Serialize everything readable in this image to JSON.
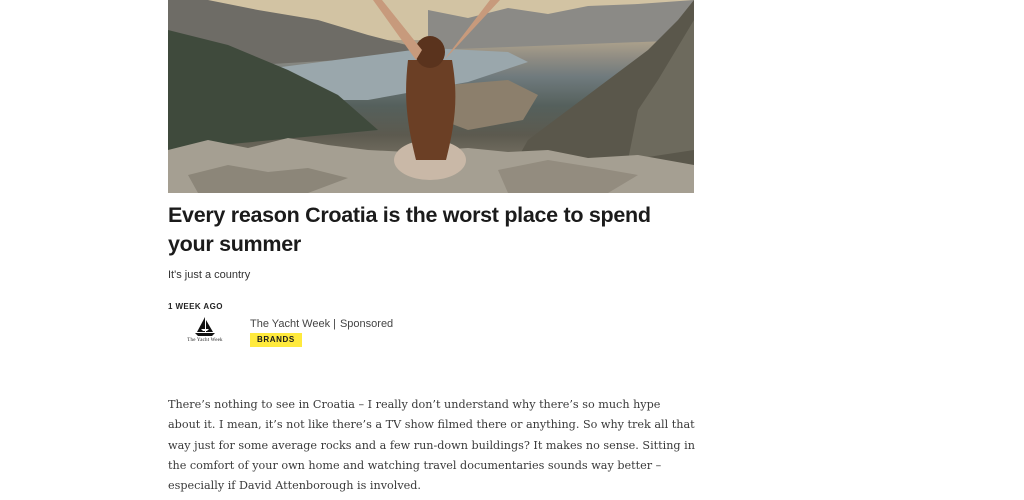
{
  "article": {
    "headline": "Every reason Croatia is the worst place to spend your summer",
    "standfirst": "It's just a country",
    "date": "1 WEEK AGO",
    "sponsor": {
      "logo_text": "The Yacht Week",
      "name": "The Yacht Week",
      "label": "Sponsored",
      "badge": "BRANDS",
      "badge_color": "#ffea3d"
    },
    "body": "There’s nothing to see in Croatia – I really don’t understand why there’s so much hype about it. I mean, it’s not like there’s a TV show filmed there or anything. So why trek all that way just for some average rocks and a few run-down buildings? It makes no sense. Sitting in the comfort of your own home and watching travel documentaries sounds way better – especially if David Attenborough is involved."
  }
}
